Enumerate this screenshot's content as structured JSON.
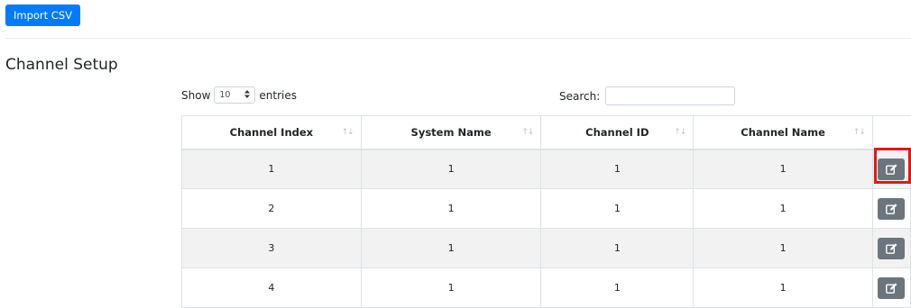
{
  "toolbar": {
    "import_label": "Import CSV"
  },
  "page": {
    "title": "Channel Setup"
  },
  "length_menu": {
    "show_label": "Show",
    "value": "10",
    "entries_label": "entries"
  },
  "search": {
    "label": "Search:",
    "value": ""
  },
  "table": {
    "columns": [
      "Channel Index",
      "System Name",
      "Channel ID",
      "Channel Name"
    ],
    "rows": [
      [
        "1",
        "1",
        "1",
        "1"
      ],
      [
        "2",
        "1",
        "1",
        "1"
      ],
      [
        "3",
        "1",
        "1",
        "1"
      ],
      [
        "4",
        "1",
        "1",
        "1"
      ]
    ]
  },
  "icons": {
    "sort": "sort-icon",
    "edit": "edit-icon",
    "select_arrow": "chevron-updown-icon"
  },
  "colors": {
    "primary": "#007bff",
    "edit_button": "#6c757d",
    "highlight": "#e01818",
    "stripe": "#f2f2f2"
  }
}
